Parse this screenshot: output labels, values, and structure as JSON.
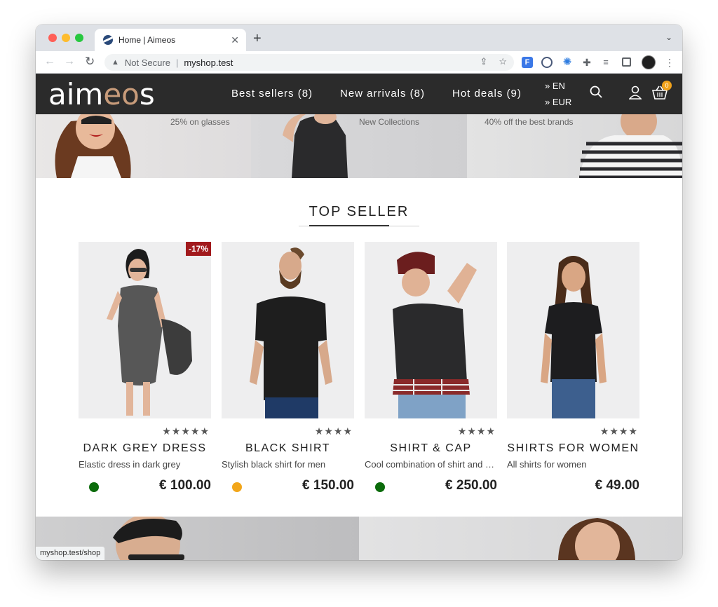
{
  "browser": {
    "tab_title": "Home | Aimeos",
    "tab_close": "✕",
    "new_tab": "+",
    "address_security": "Not Secure",
    "address_url": "myshop.test",
    "status_url": "myshop.test/shop"
  },
  "site": {
    "logo_main": "aim",
    "logo_accent": "eo",
    "logo_end": "s",
    "nav": [
      {
        "label": "Best sellers (8)"
      },
      {
        "label": "New arrivals (8)"
      },
      {
        "label": "Hot deals (9)"
      }
    ],
    "language": "» EN",
    "currency": "» EUR",
    "basket_count": "0"
  },
  "hero": [
    {
      "subtitle": "25% on glasses"
    },
    {
      "subtitle": "New Collections"
    },
    {
      "subtitle": "40% off the best brands"
    }
  ],
  "section_title": "TOP SELLER",
  "products": [
    {
      "name": "DARK GREY DRESS",
      "description": "Elastic dress in dark grey",
      "price": "€ 100.00",
      "stars": "★★★★★",
      "badge": "-17%",
      "dot_color": "#0b6b0b"
    },
    {
      "name": "BLACK SHIRT",
      "description": "Stylish black shirt for men",
      "price": "€ 150.00",
      "stars": "★★★★",
      "dot_color": "#f2a61a"
    },
    {
      "name": "SHIRT & CAP",
      "description": "Cool combination of shirt and cap",
      "price": "€ 250.00",
      "stars": "★★★★",
      "dot_color": "#0b6b0b"
    },
    {
      "name": "SHIRTS FOR WOMEN",
      "description": "All shirts for women",
      "price": "€ 49.00",
      "stars": "★★★★"
    }
  ]
}
